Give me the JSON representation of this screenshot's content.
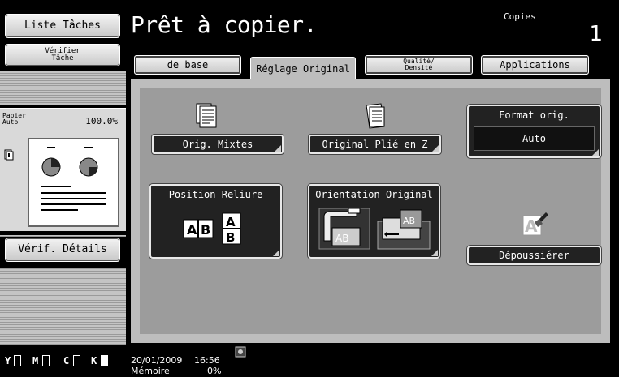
{
  "sidebar": {
    "liste_label": "Liste Tâches",
    "verifier_line1": "Vérifier",
    "verifier_line2": "Tâche",
    "paper_line1": "Papier",
    "paper_line2": "Auto",
    "zoom": "100.0%",
    "verif_details_label": "Vérif. Détails",
    "ink": [
      "Y",
      "M",
      "C",
      "K"
    ]
  },
  "header": {
    "status": "Prêt à copier.",
    "copies_label": "Copies",
    "copies_count": "1"
  },
  "tabs": {
    "base": "de base",
    "reglage": "Réglage Original",
    "qualite_line1": "Qualité/",
    "qualite_line2": "Densité",
    "applications": "Applications"
  },
  "main": {
    "orig_mixtes": "Orig. Mixtes",
    "plie_z": "Original Plié en Z",
    "format_label": "Format orig.",
    "format_value": "Auto",
    "reliure_label": "Position Reliure",
    "orientation_label": "Orientation Original",
    "depoussierer": "Dépoussiérer"
  },
  "footer": {
    "date": "20/01/2009",
    "time": "16:56",
    "memory_label": "Mémoire",
    "memory_value": "0%"
  },
  "colors": {
    "screen_bg": "#000000",
    "panel_grey": "#bdbdbd",
    "content_grey": "#9c9c9c",
    "button_dark": "#222222"
  }
}
